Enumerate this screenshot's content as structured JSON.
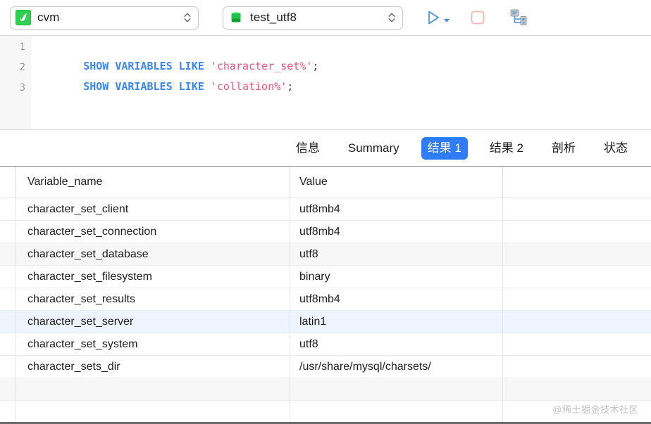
{
  "toolbar": {
    "connection": {
      "icon": "mysql-dolphin-icon",
      "label": "cvm",
      "stepper_icon": "up-down-chevron-icon"
    },
    "database": {
      "icon": "database-cylinder-icon",
      "label": "test_utf8",
      "stepper_icon": "up-down-chevron-icon"
    },
    "actions": [
      {
        "name": "run-query-button",
        "icon": "play-triangle-icon",
        "label": "",
        "color": "#4a90d9"
      },
      {
        "name": "run-options-caret",
        "icon": "caret-down-icon",
        "label": "",
        "color": "#4a90d9"
      },
      {
        "name": "stop-query-button",
        "icon": "stop-square-icon",
        "label": "",
        "color": "#f3b4b4"
      },
      {
        "name": "explain-plan-button",
        "icon": "query-plan-tree-icon",
        "label": "",
        "color": "#4a90d9"
      }
    ]
  },
  "editor": {
    "line_numbers": [
      "1",
      "2",
      "3"
    ],
    "lines": [
      {
        "keyword": "SHOW VARIABLES LIKE ",
        "string": "'character_set%'",
        "punct": ";"
      },
      {
        "keyword": "SHOW VARIABLES LIKE ",
        "string": "'collation%'",
        "punct": ";"
      },
      {
        "keyword": "",
        "string": "",
        "punct": ""
      }
    ],
    "scrollbar": "horizontal-scrollbar"
  },
  "tabs": [
    {
      "label": "信息",
      "active": false
    },
    {
      "label": "Summary",
      "active": false
    },
    {
      "label": "结果 1",
      "active": true
    },
    {
      "label": "结果 2",
      "active": false
    },
    {
      "label": "剖析",
      "active": false
    },
    {
      "label": "状态",
      "active": false
    }
  ],
  "result_grid": {
    "columns": [
      "Variable_name",
      "Value"
    ],
    "rows": [
      {
        "name": "character_set_client",
        "value": "utf8mb4",
        "style": "plain"
      },
      {
        "name": "character_set_connection",
        "value": "utf8mb4",
        "style": "plain"
      },
      {
        "name": "character_set_database",
        "value": "utf8",
        "style": "alt"
      },
      {
        "name": "character_set_filesystem",
        "value": "binary",
        "style": "plain"
      },
      {
        "name": "character_set_results",
        "value": "utf8mb4",
        "style": "plain"
      },
      {
        "name": "character_set_server",
        "value": "latin1",
        "style": "selected"
      },
      {
        "name": "character_set_system",
        "value": "utf8",
        "style": "plain"
      },
      {
        "name": "character_sets_dir",
        "value": "/usr/share/mysql/charsets/",
        "style": "plain"
      },
      {
        "name": "",
        "value": "",
        "style": "alt"
      },
      {
        "name": "",
        "value": "",
        "style": "plain"
      }
    ]
  },
  "watermark": "@稀土掘金技术社区",
  "colors": {
    "accent_blue": "#2f7cf6",
    "keyword_blue": "#3b87ef",
    "string_pink": "#e8567c",
    "selected_row": "#eef4fd",
    "alt_row": "#f7f7f7",
    "db_green": "#22bb44"
  }
}
